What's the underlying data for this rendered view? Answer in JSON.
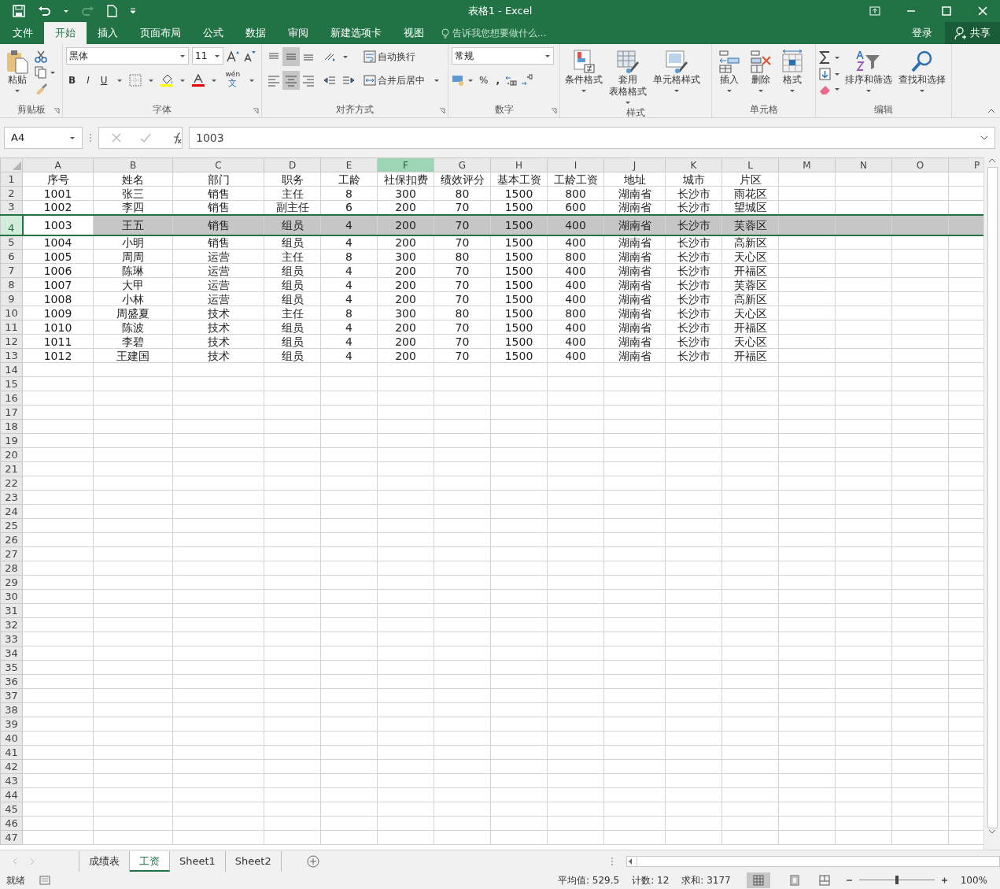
{
  "window": {
    "title": "表格1 - Excel"
  },
  "ribbon_tabs": [
    {
      "label": "文件",
      "selected": false
    },
    {
      "label": "开始",
      "selected": true
    },
    {
      "label": "插入",
      "selected": false
    },
    {
      "label": "页面布局",
      "selected": false
    },
    {
      "label": "公式",
      "selected": false
    },
    {
      "label": "数据",
      "selected": false
    },
    {
      "label": "审阅",
      "selected": false
    },
    {
      "label": "新建选项卡",
      "selected": false
    },
    {
      "label": "视图",
      "selected": false
    }
  ],
  "tell_me": {
    "placeholder": "告诉我您想要做什么..."
  },
  "account": {
    "sign_in": "登录",
    "share": "共享"
  },
  "ribbon": {
    "clipboard": {
      "title": "剪贴板",
      "paste": "粘贴"
    },
    "font": {
      "title": "字体",
      "font_name": "黑体",
      "font_size": "11",
      "bold": "B",
      "italic": "I",
      "underline": "U",
      "phonetic": "wén",
      "phonetic_char": "文"
    },
    "alignment": {
      "title": "对齐方式",
      "wrap_text": "自动换行",
      "merge_center": "合并后居中",
      "vertical_buttons": [
        {
          "kind": "top",
          "selected": false
        },
        {
          "kind": "middle",
          "selected": true
        },
        {
          "kind": "bottom",
          "selected": false
        }
      ],
      "horizontal_buttons": [
        {
          "kind": "left",
          "selected": false
        },
        {
          "kind": "center",
          "selected": true
        },
        {
          "kind": "right",
          "selected": false
        }
      ]
    },
    "number": {
      "title": "数字",
      "format": "常规",
      "percent": "%",
      "comma": ","
    },
    "styles": {
      "title": "样式",
      "buttons": [
        {
          "kind": "conditional",
          "label": "条件格式"
        },
        {
          "kind": "table",
          "lines": [
            "套用",
            "表格格式"
          ]
        },
        {
          "kind": "cellstyle",
          "label": "单元格样式"
        }
      ]
    },
    "cells": {
      "title": "单元格",
      "buttons": [
        {
          "kind": "insert",
          "label": "插入"
        },
        {
          "kind": "delete",
          "label": "删除"
        },
        {
          "kind": "format",
          "label": "格式"
        }
      ]
    },
    "editing": {
      "title": "编辑",
      "buttons": [
        {
          "kind": "sort",
          "label": "排序和筛选"
        },
        {
          "kind": "find",
          "label": "查找和选择"
        }
      ]
    }
  },
  "formula_bar": {
    "name_box": "A4",
    "value": "1003"
  },
  "sheet": {
    "columns": [
      {
        "label": "A",
        "selected": false
      },
      {
        "label": "B",
        "selected": false
      },
      {
        "label": "C",
        "selected": false
      },
      {
        "label": "D",
        "selected": false
      },
      {
        "label": "E",
        "selected": false
      },
      {
        "label": "F",
        "selected": true
      },
      {
        "label": "G",
        "selected": false
      },
      {
        "label": "H",
        "selected": false
      },
      {
        "label": "I",
        "selected": false
      },
      {
        "label": "J",
        "selected": false
      },
      {
        "label": "K",
        "selected": false
      },
      {
        "label": "L",
        "selected": false
      },
      {
        "label": "M",
        "selected": false
      },
      {
        "label": "N",
        "selected": false
      },
      {
        "label": "O",
        "selected": false
      },
      {
        "label": "P",
        "selected": false
      }
    ],
    "rows": [
      {
        "number": "1",
        "selected": false,
        "cells": [
          "序号",
          "姓名",
          "部门",
          "职务",
          "工龄",
          "社保扣费",
          "绩效评分",
          "基本工资",
          "工龄工资",
          "地址",
          "城市",
          "片区"
        ]
      },
      {
        "number": "2",
        "selected": false,
        "cells": [
          "1001",
          "张三",
          "销售",
          "主任",
          "8",
          "300",
          "80",
          "1500",
          "800",
          "湖南省",
          "长沙市",
          "雨花区"
        ]
      },
      {
        "number": "3",
        "selected": false,
        "cells": [
          "1002",
          "李四",
          "销售",
          "副主任",
          "6",
          "200",
          "70",
          "1500",
          "600",
          "湖南省",
          "长沙市",
          "望城区"
        ]
      },
      {
        "number": "4",
        "selected": true,
        "cells": [
          "1003",
          "王五",
          "销售",
          "组员",
          "4",
          "200",
          "70",
          "1500",
          "400",
          "湖南省",
          "长沙市",
          "芙蓉区"
        ]
      },
      {
        "number": "5",
        "selected": false,
        "cells": [
          "1004",
          "小明",
          "销售",
          "组员",
          "4",
          "200",
          "70",
          "1500",
          "400",
          "湖南省",
          "长沙市",
          "高新区"
        ]
      },
      {
        "number": "6",
        "selected": false,
        "cells": [
          "1005",
          "周周",
          "运营",
          "主任",
          "8",
          "300",
          "80",
          "1500",
          "800",
          "湖南省",
          "长沙市",
          "天心区"
        ]
      },
      {
        "number": "7",
        "selected": false,
        "cells": [
          "1006",
          "陈琳",
          "运营",
          "组员",
          "4",
          "200",
          "70",
          "1500",
          "400",
          "湖南省",
          "长沙市",
          "开福区"
        ]
      },
      {
        "number": "8",
        "selected": false,
        "cells": [
          "1007",
          "大甲",
          "运营",
          "组员",
          "4",
          "200",
          "70",
          "1500",
          "400",
          "湖南省",
          "长沙市",
          "芙蓉区"
        ]
      },
      {
        "number": "9",
        "selected": false,
        "cells": [
          "1008",
          "小林",
          "运营",
          "组员",
          "4",
          "200",
          "70",
          "1500",
          "400",
          "湖南省",
          "长沙市",
          "高新区"
        ]
      },
      {
        "number": "10",
        "selected": false,
        "cells": [
          "1009",
          "周盛夏",
          "技术",
          "主任",
          "8",
          "300",
          "80",
          "1500",
          "800",
          "湖南省",
          "长沙市",
          "天心区"
        ]
      },
      {
        "number": "11",
        "selected": false,
        "cells": [
          "1010",
          "陈波",
          "技术",
          "组员",
          "4",
          "200",
          "70",
          "1500",
          "400",
          "湖南省",
          "长沙市",
          "开福区"
        ]
      },
      {
        "number": "12",
        "selected": false,
        "cells": [
          "1011",
          "李碧",
          "技术",
          "组员",
          "4",
          "200",
          "70",
          "1500",
          "400",
          "湖南省",
          "长沙市",
          "天心区"
        ]
      },
      {
        "number": "13",
        "selected": false,
        "cells": [
          "1012",
          "王建国",
          "技术",
          "组员",
          "4",
          "200",
          "70",
          "1500",
          "400",
          "湖南省",
          "长沙市",
          "开福区"
        ]
      },
      {
        "number": "14",
        "selected": false
      },
      {
        "number": "15",
        "selected": false
      },
      {
        "number": "16",
        "selected": false
      },
      {
        "number": "17",
        "selected": false
      },
      {
        "number": "18",
        "selected": false
      },
      {
        "number": "19",
        "selected": false
      },
      {
        "number": "20",
        "selected": false
      },
      {
        "number": "21",
        "selected": false
      },
      {
        "number": "22",
        "selected": false
      },
      {
        "number": "23",
        "selected": false
      },
      {
        "number": "24",
        "selected": false
      },
      {
        "number": "25",
        "selected": false
      },
      {
        "number": "26",
        "selected": false
      },
      {
        "number": "27",
        "selected": false
      },
      {
        "number": "28",
        "selected": false
      },
      {
        "number": "29",
        "selected": false
      },
      {
        "number": "30",
        "selected": false
      },
      {
        "number": "31",
        "selected": false
      },
      {
        "number": "32",
        "selected": false
      },
      {
        "number": "33",
        "selected": false
      },
      {
        "number": "34",
        "selected": false
      },
      {
        "number": "35",
        "selected": false
      },
      {
        "number": "36",
        "selected": false
      },
      {
        "number": "37",
        "selected": false
      },
      {
        "number": "38",
        "selected": false
      },
      {
        "number": "39",
        "selected": false
      },
      {
        "number": "40",
        "selected": false
      },
      {
        "number": "41",
        "selected": false
      },
      {
        "number": "42",
        "selected": false
      },
      {
        "number": "43",
        "selected": false
      },
      {
        "number": "44",
        "selected": false
      },
      {
        "number": "45",
        "selected": false
      },
      {
        "number": "46",
        "selected": false
      },
      {
        "number": "47",
        "selected": false
      }
    ]
  },
  "sheet_tabs": [
    {
      "label": "成绩表",
      "selected": false
    },
    {
      "label": "工资",
      "selected": true
    },
    {
      "label": "Sheet1",
      "selected": false
    },
    {
      "label": "Sheet2",
      "selected": false
    }
  ],
  "status_bar": {
    "status": "就绪",
    "stats": [
      "平均值: 529.5",
      "计数: 12",
      "求和: 3177"
    ],
    "zoom": {
      "level": 0.5,
      "label": "100%"
    }
  }
}
